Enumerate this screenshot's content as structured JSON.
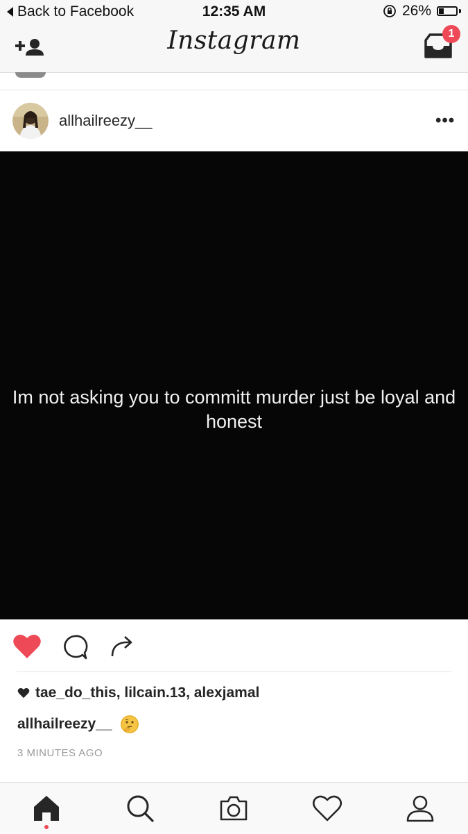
{
  "status_bar": {
    "back_label": "Back to Facebook",
    "time": "12:35 AM",
    "battery_percent": "26%",
    "battery_level": 0.26
  },
  "nav": {
    "logo": "Instagram",
    "add_person_icon": "add-person-icon",
    "inbox_icon": "inbox-icon",
    "inbox_badge": "1"
  },
  "post": {
    "username": "allhailreezy__",
    "more_label": "•••",
    "image_text": "Im not asking you to committ murder just be loyal and honest",
    "liked": true,
    "likes": "tae_do_this, lilcain.13, alexjamal",
    "caption_user": "allhailreezy__",
    "caption_emoji": "thinking-face",
    "time_ago": "3 MINUTES AGO"
  },
  "tabs": [
    {
      "name": "home",
      "active": true
    },
    {
      "name": "search",
      "active": false
    },
    {
      "name": "camera",
      "active": false
    },
    {
      "name": "activity",
      "active": false
    },
    {
      "name": "profile",
      "active": false
    }
  ],
  "colors": {
    "like_red": "#ed4956",
    "text": "#262626",
    "muted": "#999999",
    "post_bg": "#060606"
  }
}
